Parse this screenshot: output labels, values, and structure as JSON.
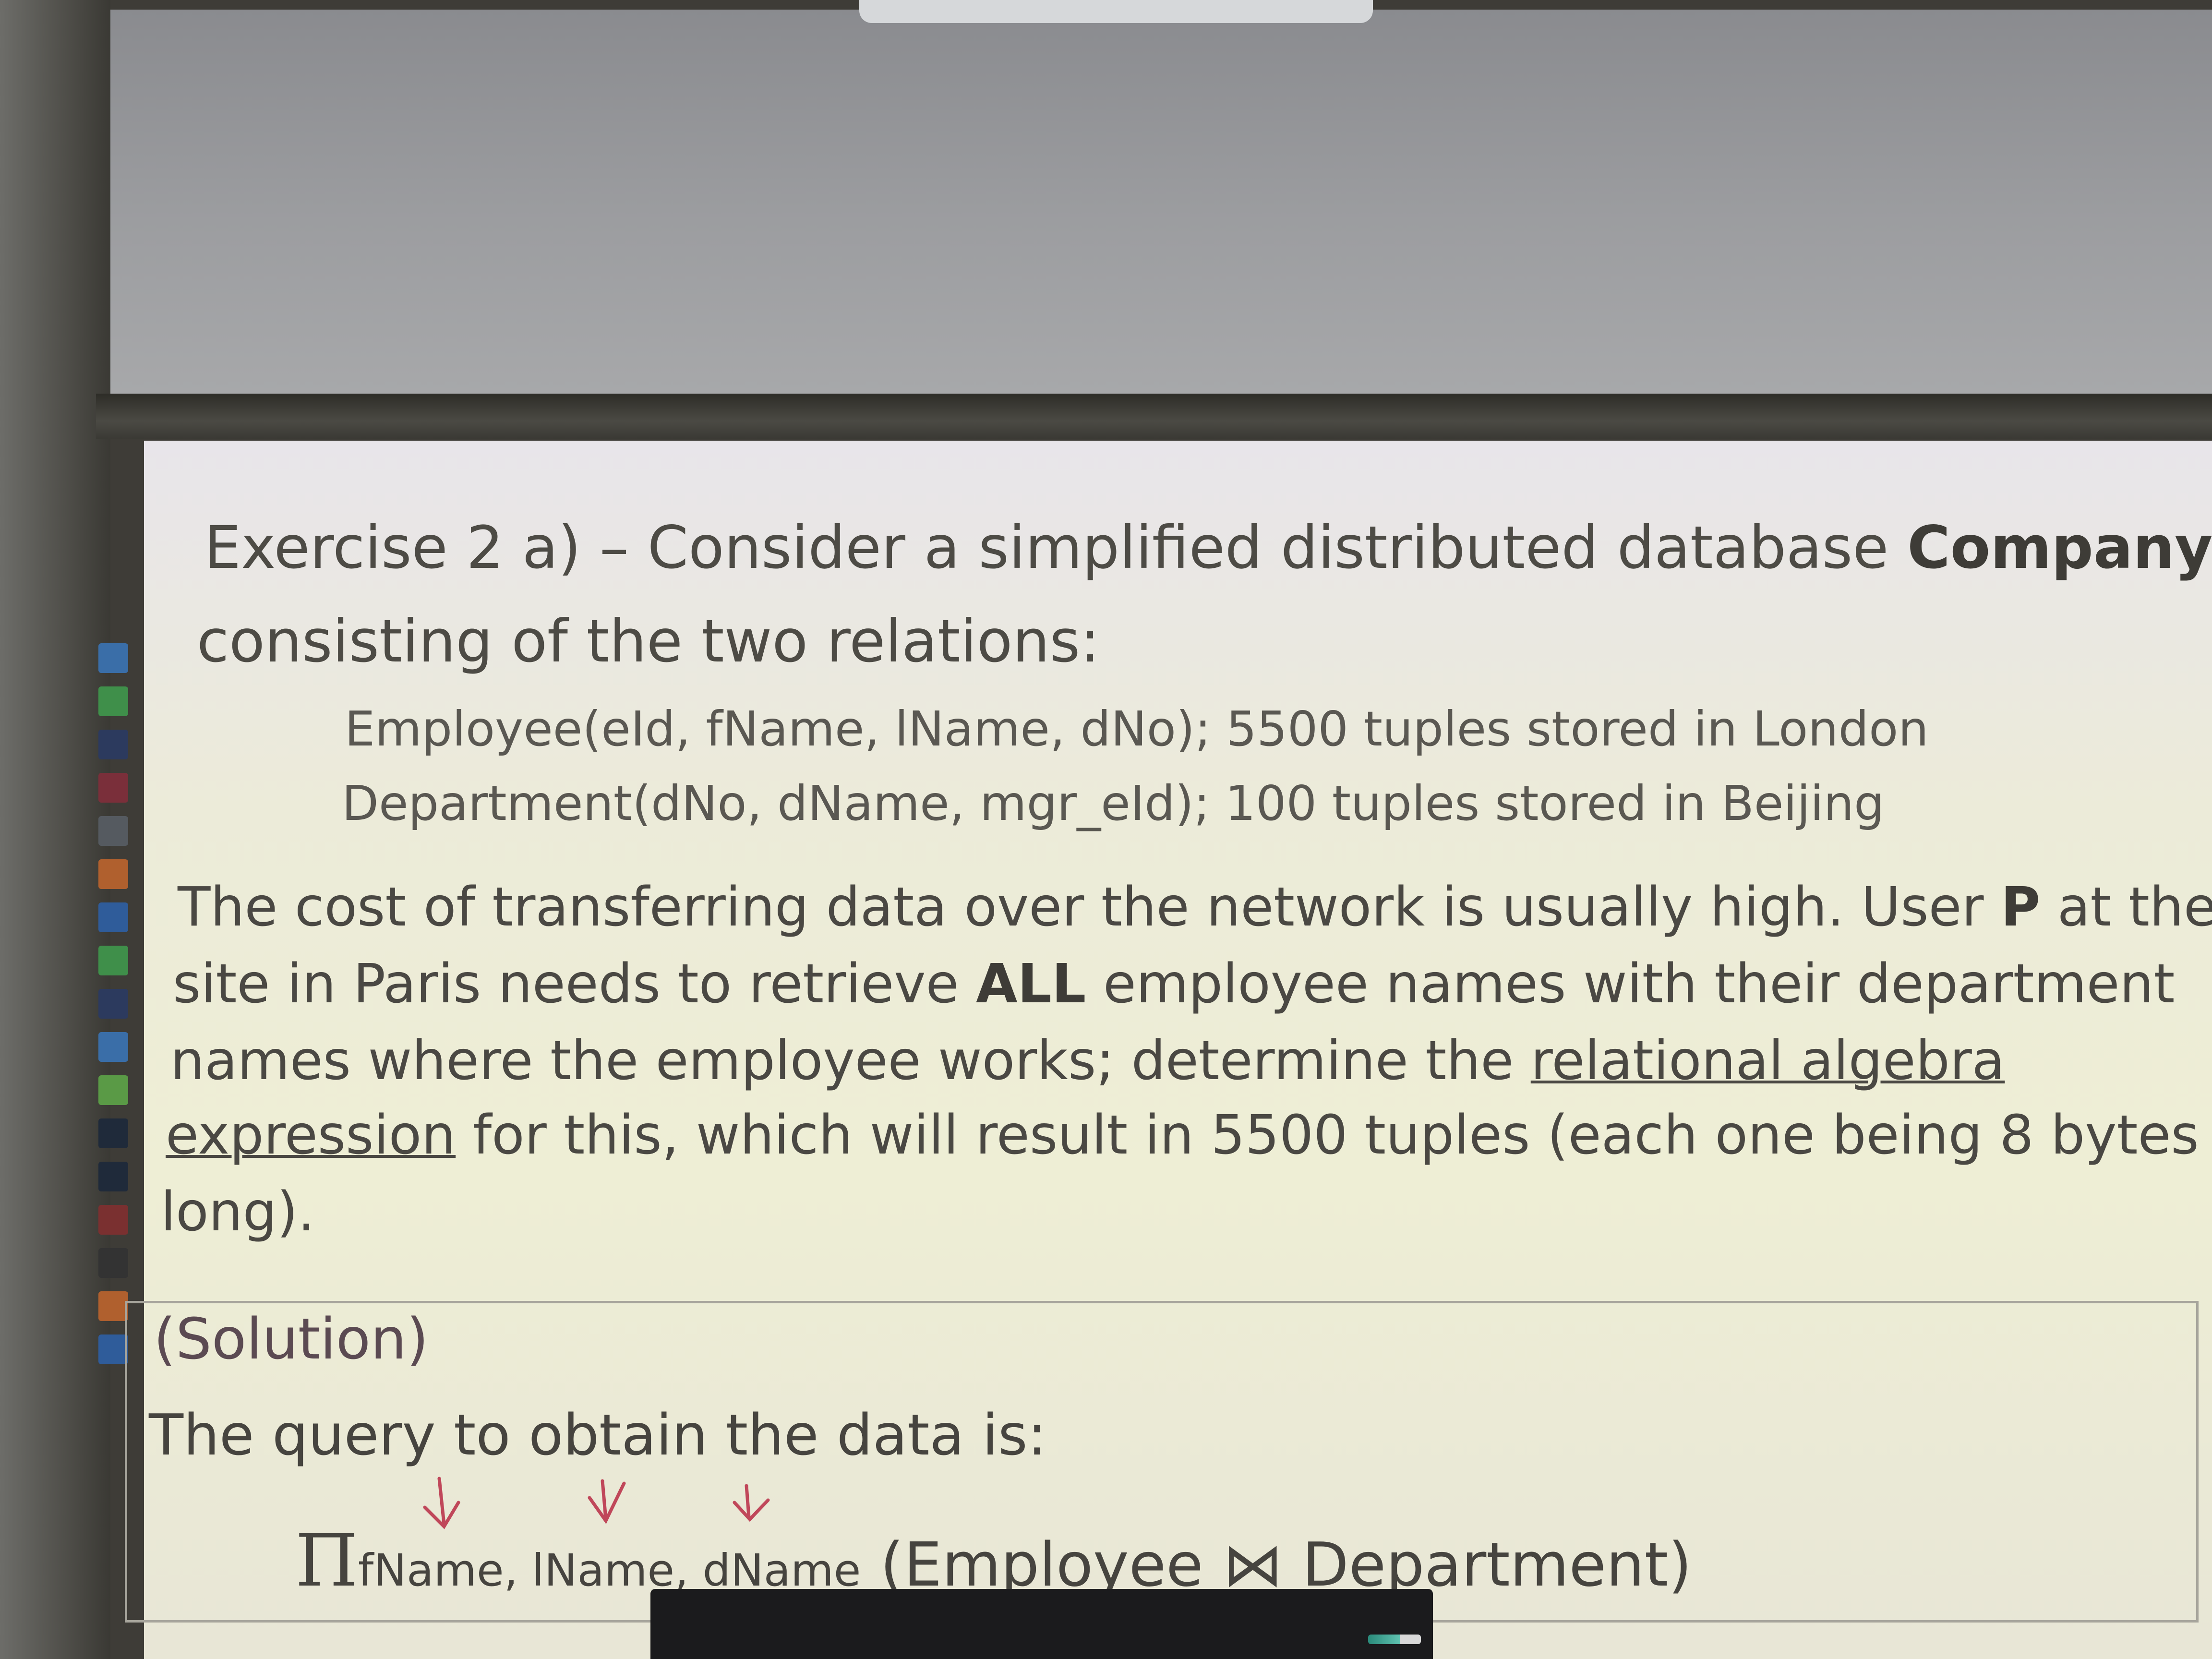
{
  "slide": {
    "title_prefix": "Exercise 2 a)",
    "title_dash": " – ",
    "title_text": "Consider a simplified distributed database ",
    "title_bold": "Company",
    "title_line2": "consisting of the two relations:",
    "relations": [
      "Employee(eId, fName, lName, dNo); 5500 tuples stored in London",
      "Department(dNo, dName, mgr_eId); 100 tuples stored in Beijing"
    ],
    "paragraph": {
      "line1_a": "The cost of transferring data over the network is usually high. User ",
      "line1_bold": "P",
      "line1_b": " at the",
      "line2_a": "site in Paris needs to retrieve ",
      "line2_bold": "ALL",
      "line2_b": " employee names with their department",
      "line3_a": "names where the employee works; determine the ",
      "line3_underlined": "relational algebra",
      "line4_underlined": "expression",
      "line4_b": " for this, which will result in 5500 tuples (each one being 8 bytes",
      "line5": "long)."
    },
    "solution": {
      "heading": "(Solution)",
      "intro": "The query to obtain the data is:",
      "pi": "Π",
      "projection": "fName, lName, dName",
      "join": " (Employee ⋈ Department)"
    }
  },
  "annotation_color": "#c0475a",
  "toolbar_colors": [
    "#3a6ea8",
    "#3f8f4a",
    "#2c3a5e",
    "#7a2f3a",
    "#555a60",
    "#b0602e",
    "#2f5c9a",
    "#3f8f4a",
    "#2c3a5e",
    "#3a6ea8",
    "#5a9a46",
    "#1f2a3a",
    "#1f2a3a",
    "#7a3030",
    "#333333",
    "#b0602e",
    "#2f5c9a"
  ]
}
